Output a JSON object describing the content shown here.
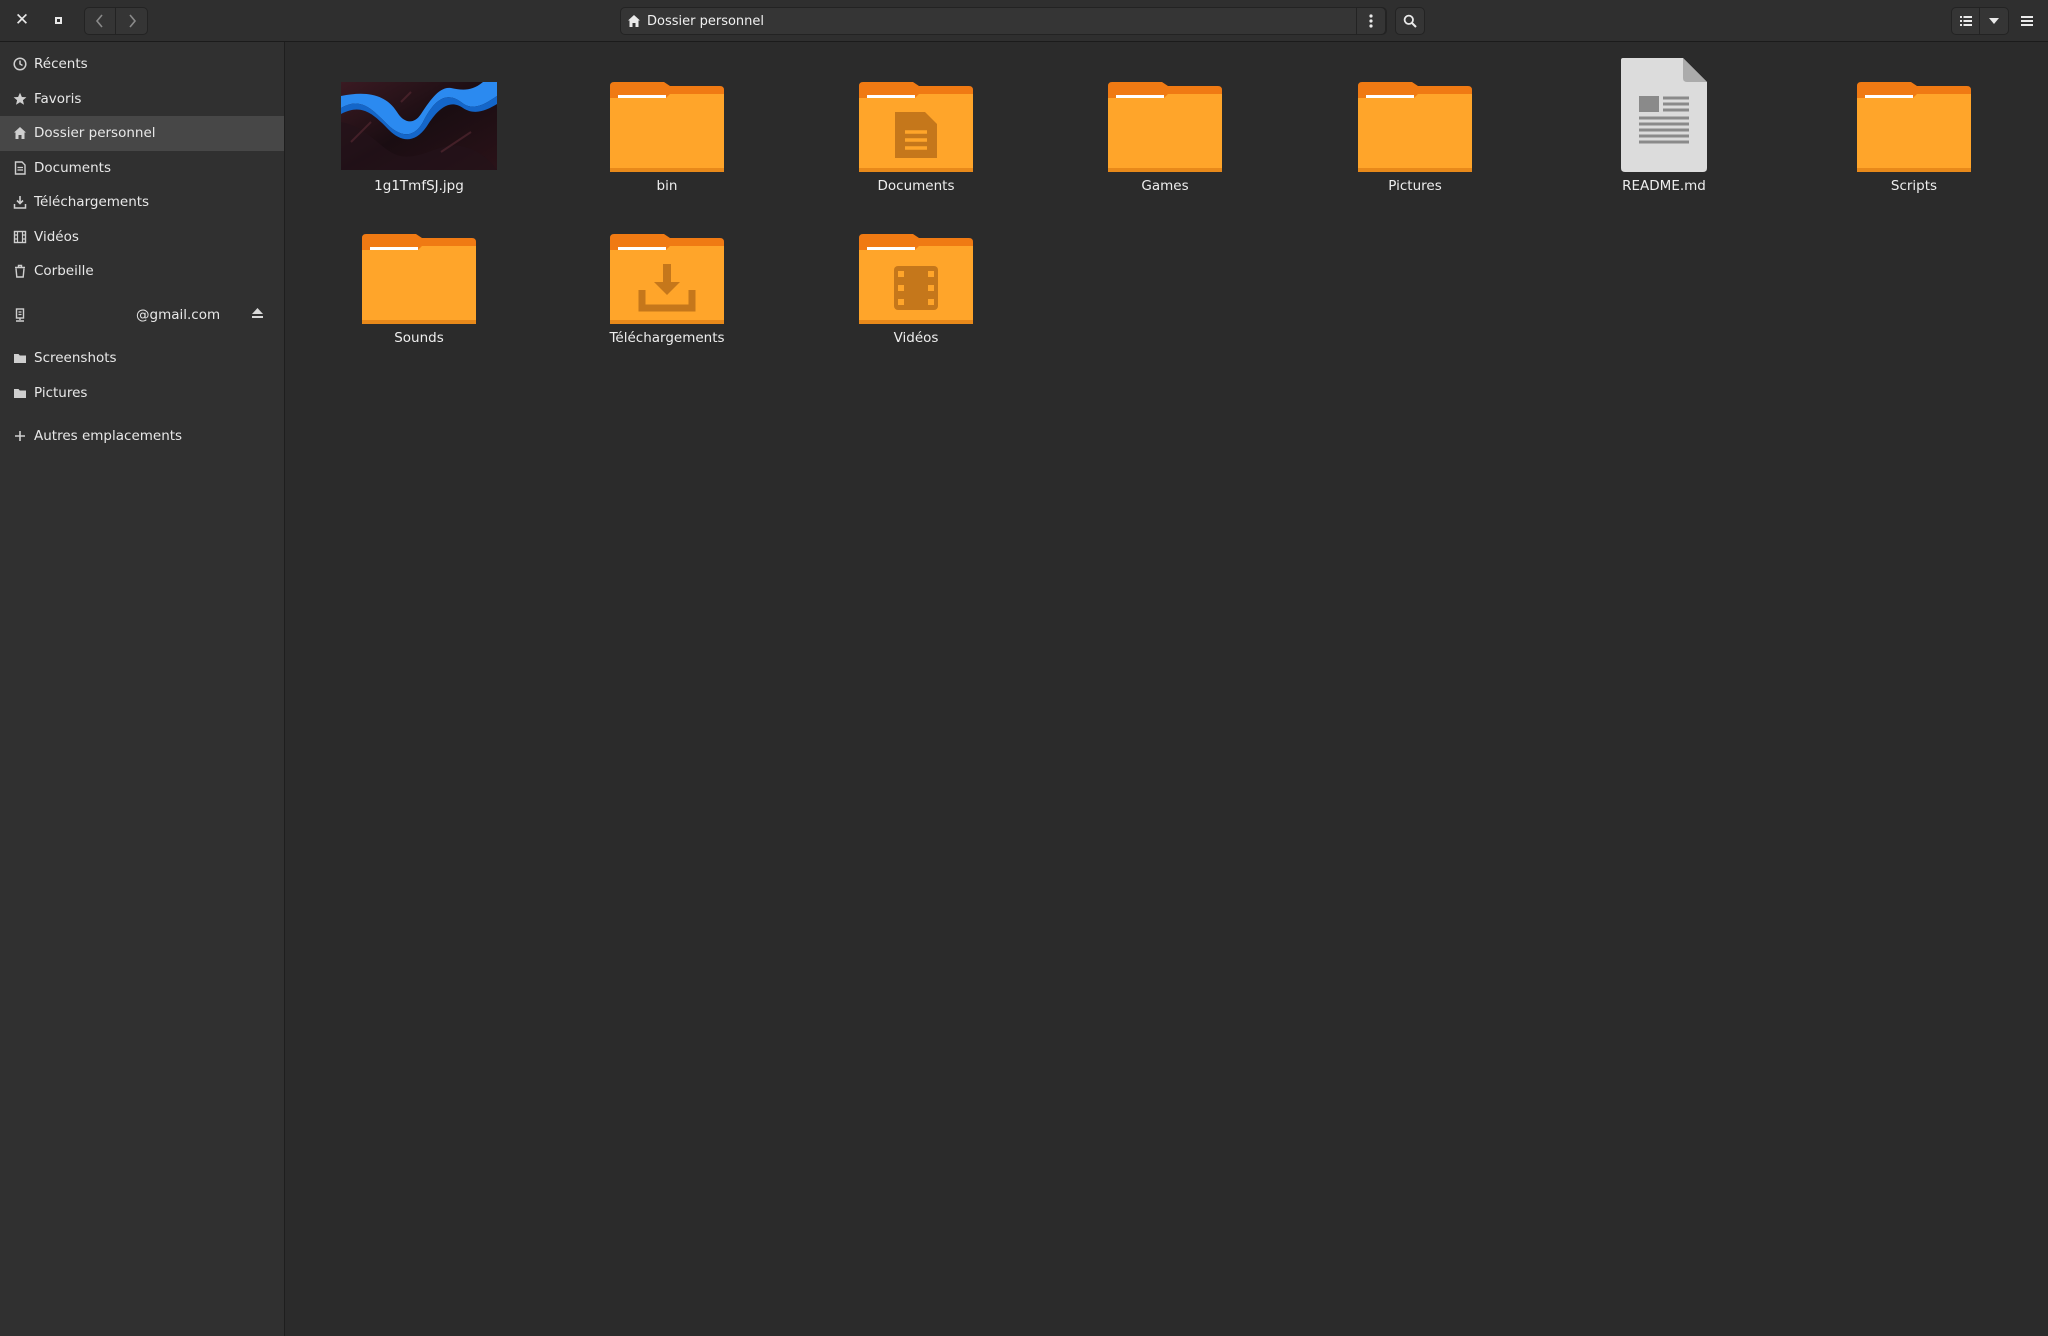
{
  "window": {
    "title": "Dossier personnel"
  },
  "pathbar": {
    "location": "Dossier personnel",
    "location_icon": "home-icon"
  },
  "sidebar": {
    "items": [
      {
        "label": "Récents",
        "icon": "clock-icon"
      },
      {
        "label": "Favoris",
        "icon": "star-icon"
      },
      {
        "label": "Dossier personnel",
        "icon": "home-icon",
        "active": true
      },
      {
        "label": "Documents",
        "icon": "document-icon"
      },
      {
        "label": "Téléchargements",
        "icon": "download-icon"
      },
      {
        "label": "Vidéos",
        "icon": "film-icon"
      },
      {
        "label": "Corbeille",
        "icon": "trash-icon"
      }
    ],
    "mount": {
      "label": "@gmail.com",
      "icon": "network-drive-icon",
      "action_icon": "eject-icon"
    },
    "bookmarks": [
      {
        "label": "Screenshots",
        "icon": "folder-icon"
      },
      {
        "label": "Pictures",
        "icon": "folder-icon"
      }
    ],
    "other": {
      "label": "Autres emplacements",
      "icon": "plus-icon"
    }
  },
  "files": [
    {
      "name": "1g1TmfSJ.jpg",
      "kind": "image"
    },
    {
      "name": "bin",
      "kind": "folder"
    },
    {
      "name": "Documents",
      "kind": "folder-documents"
    },
    {
      "name": "Games",
      "kind": "folder"
    },
    {
      "name": "Pictures",
      "kind": "folder"
    },
    {
      "name": "README.md",
      "kind": "text-file"
    },
    {
      "name": "Scripts",
      "kind": "folder"
    },
    {
      "name": "Sounds",
      "kind": "folder"
    },
    {
      "name": "Téléchargements",
      "kind": "folder-download"
    },
    {
      "name": "Vidéos",
      "kind": "folder-videos"
    }
  ],
  "colors": {
    "folder_body": "#ffa52a",
    "folder_back": "#f07a13",
    "folder_emblem": "#c5771b",
    "background": "#2b2b2b",
    "sidebar": "#303030",
    "sidebar_active": "#474747"
  }
}
